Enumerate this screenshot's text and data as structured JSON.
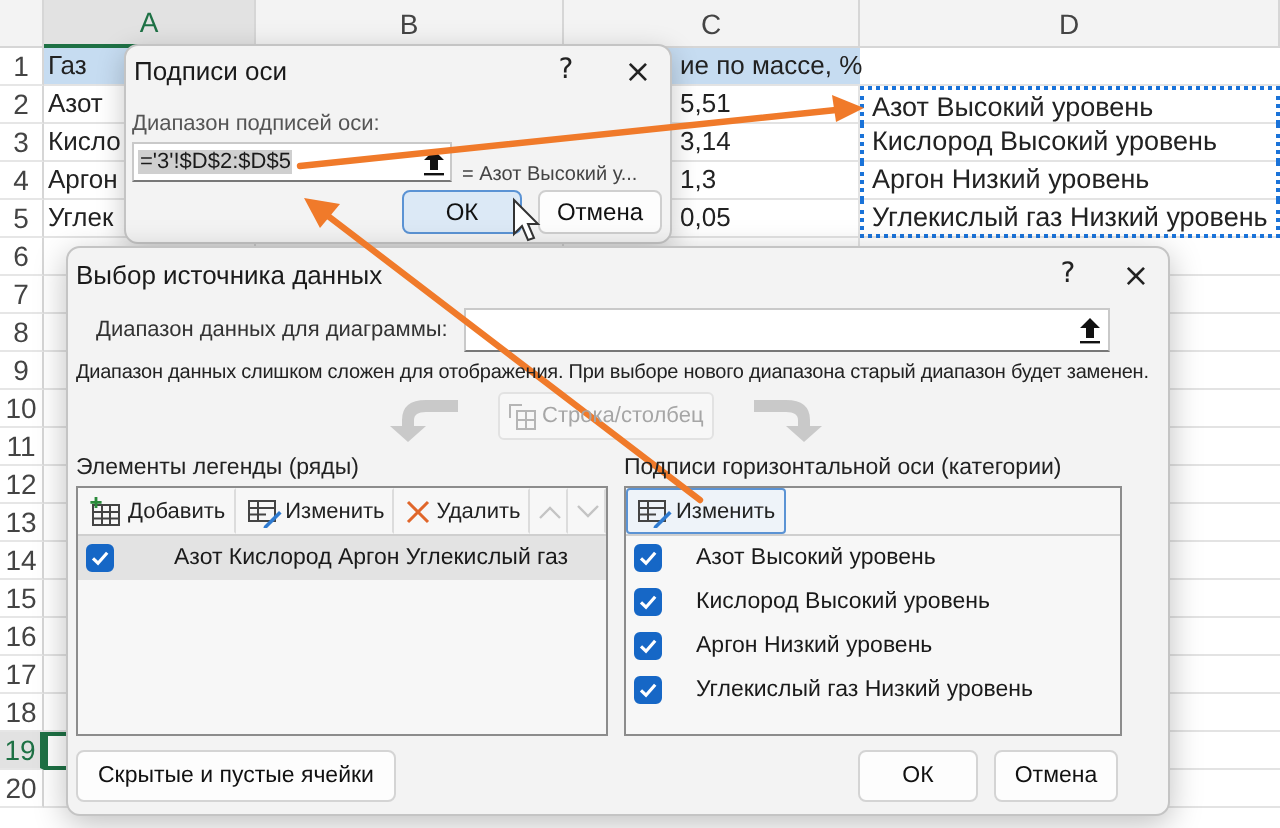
{
  "sheet": {
    "columns": [
      {
        "label": "A",
        "selected": true
      },
      {
        "label": "B",
        "selected": false
      },
      {
        "label": "C",
        "selected": false
      },
      {
        "label": "D",
        "selected": false
      }
    ],
    "rows": [
      {
        "number": "1",
        "selected": false,
        "cells": {
          "a": {
            "text": "Газ",
            "kind": "header"
          },
          "c": {
            "text": "ие по массе, %",
            "kind": "header"
          }
        }
      },
      {
        "number": "2",
        "selected": false,
        "cells": {
          "a": {
            "text": "Азот",
            "kind": "plain"
          },
          "c": {
            "text": "5,51",
            "kind": "plain"
          },
          "d": {
            "text": "Азот Высокий уровень",
            "kind": "copied"
          }
        }
      },
      {
        "number": "3",
        "selected": false,
        "cells": {
          "a": {
            "text": "Кисло",
            "kind": "plain"
          },
          "c": {
            "text": "3,14",
            "kind": "plain"
          },
          "d": {
            "text": "Кислород Высокий уровень",
            "kind": "copied"
          }
        }
      },
      {
        "number": "4",
        "selected": false,
        "cells": {
          "a": {
            "text": "Аргон",
            "kind": "plain"
          },
          "c": {
            "text": "1,3",
            "kind": "plain"
          },
          "d": {
            "text": "Аргон Низкий уровень",
            "kind": "copied"
          }
        }
      },
      {
        "number": "5",
        "selected": false,
        "cells": {
          "a": {
            "text": "Углек",
            "kind": "plain"
          },
          "c": {
            "text": "0,05",
            "kind": "plain"
          },
          "d": {
            "text": "Углекислый газ Низкий уровень",
            "kind": "copied"
          }
        }
      },
      {
        "number": "6",
        "selected": false
      },
      {
        "number": "7",
        "selected": false
      },
      {
        "number": "8",
        "selected": false
      },
      {
        "number": "9",
        "selected": false
      },
      {
        "number": "10",
        "selected": false
      },
      {
        "number": "11",
        "selected": false
      },
      {
        "number": "12",
        "selected": false
      },
      {
        "number": "13",
        "selected": false
      },
      {
        "number": "14",
        "selected": false
      },
      {
        "number": "15",
        "selected": false
      },
      {
        "number": "16",
        "selected": false
      },
      {
        "number": "17",
        "selected": false
      },
      {
        "number": "18",
        "selected": false
      },
      {
        "number": "19",
        "selected": true
      },
      {
        "number": "20",
        "selected": false
      }
    ]
  },
  "axis_dialog": {
    "title": "Подписи оси",
    "help": "?",
    "close": "×",
    "label": "Диапазон подписей оси:",
    "field": {
      "value": "='3'!$D$2:$D$5",
      "selected": true
    },
    "preview": "= Азот Высокий у...",
    "buttons": [
      {
        "label": "ОК",
        "default": true
      },
      {
        "label": "Отмена",
        "default": false
      }
    ]
  },
  "source_dialog": {
    "title": "Выбор источника данных",
    "help": "?",
    "close": "×",
    "range": {
      "label": "Диапазон данных для диаграммы:"
    },
    "note": "Диапазон данных слишком сложен для отображения. При выборе нового диапазона старый диапазон будет заменен.",
    "switch_button": {
      "label": "Строка/столбец",
      "disabled": true
    },
    "legend": {
      "label": "Элементы легенды (ряды)",
      "toolbar": [
        {
          "kind": "add",
          "label": "Добавить",
          "disabled": false,
          "focused": false
        },
        {
          "kind": "edit",
          "label": "Изменить",
          "disabled": false,
          "focused": false
        },
        {
          "kind": "delete",
          "label": "Удалить",
          "disabled": false,
          "focused": false
        },
        {
          "kind": "up",
          "disabled": true,
          "focused": false
        },
        {
          "kind": "down",
          "disabled": true,
          "focused": false
        }
      ],
      "items": [
        {
          "label": "Азот Кислород Аргон Углекислый газ",
          "checked": true,
          "selected": true
        }
      ]
    },
    "axis": {
      "label": "Подписи горизонтальной оси (категории)",
      "toolbar": [
        {
          "kind": "edit",
          "label": "Изменить",
          "disabled": false,
          "focused": true
        }
      ],
      "items": [
        {
          "label": "Азот Высокий уровень",
          "checked": true,
          "selected": false
        },
        {
          "label": "Кислород Высокий уровень",
          "checked": true,
          "selected": false
        },
        {
          "label": "Аргон Низкий уровень",
          "checked": true,
          "selected": false
        },
        {
          "label": "Углекислый газ Низкий уровень",
          "checked": true,
          "selected": false
        }
      ]
    },
    "footer": {
      "hidden_cells_button": "Скрытые и пустые ячейки",
      "buttons": [
        {
          "label": "ОК",
          "default": false
        },
        {
          "label": "Отмена",
          "default": false
        }
      ]
    }
  }
}
